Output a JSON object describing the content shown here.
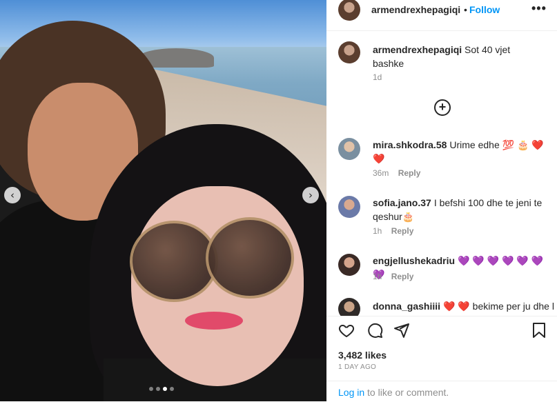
{
  "post": {
    "username": "armendrexhepagiqi",
    "follow_label": "Follow",
    "separator": "•",
    "more_label": "•••",
    "caption": "Sot 40 vjet bashke",
    "caption_time": "1d",
    "likes": "3,482 likes",
    "date": "1 DAY AGO",
    "login_link": "Log in",
    "login_rest": " to like or comment."
  },
  "carousel": {
    "prev_icon": "chevron-left-icon",
    "next_icon": "chevron-right-icon",
    "current_slide": 3,
    "total_slides": 4
  },
  "comments": [
    {
      "username": "mira.shkodra.58",
      "text": "Urime edhe 💯 🎂 ❤️ ❤️",
      "time": "36m",
      "reply": "Reply"
    },
    {
      "username": "sofia.jano.37",
      "text": "I befshi 100 dhe te jeni te qeshur🎂",
      "time": "1h",
      "reply": "Reply"
    },
    {
      "username": "engjellushekadriu",
      "text": "💜 💜 💜 💜 💜 💜 💜",
      "time": "1h",
      "reply": "Reply"
    },
    {
      "username": "donna_gashiiii",
      "text": "❤️ ❤️ bekime per ju dhe l",
      "time": "",
      "reply": ""
    }
  ],
  "colors": {
    "accent": "#0095f6",
    "text": "#262626",
    "muted": "#8e8e8e"
  }
}
